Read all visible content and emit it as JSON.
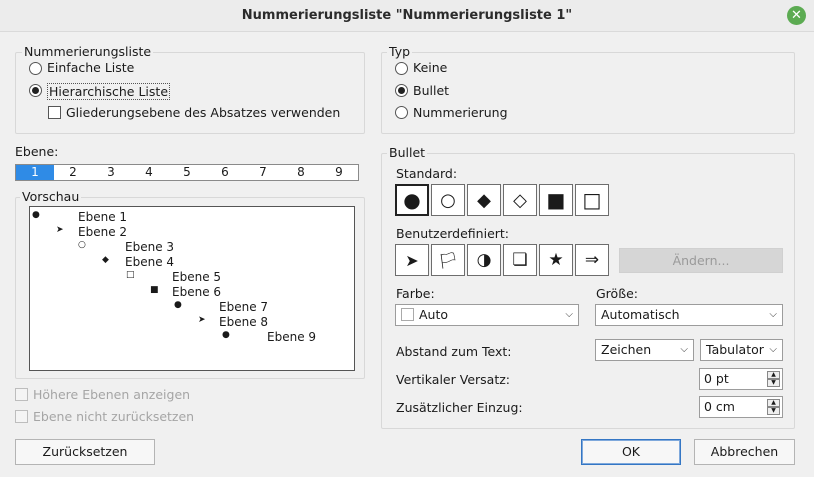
{
  "window": {
    "title": "Nummerierungsliste \"Nummerierungsliste 1\"",
    "close_symbol": "✕"
  },
  "numbering_list": {
    "group_label": "Nummerierungsliste",
    "simple": "Einfache Liste",
    "hierarchical": "Hierarchische Liste",
    "outline_checkbox": "Gliederungsebene des Absatzes verwenden",
    "selected": "hierarchical"
  },
  "type": {
    "group_label": "Typ",
    "none": "Keine",
    "bullet": "Bullet",
    "numbering": "Nummerierung",
    "selected": "bullet"
  },
  "level": {
    "label": "Ebene:",
    "items": [
      "1",
      "2",
      "3",
      "4",
      "5",
      "6",
      "7",
      "8",
      "9"
    ],
    "selected": "1"
  },
  "preview": {
    "label": "Vorschau",
    "lines": [
      {
        "text": "Ebene 1",
        "bullet": "●"
      },
      {
        "text": "Ebene 2",
        "bullet": "➤"
      },
      {
        "text": "Ebene 3",
        "bullet": "○"
      },
      {
        "text": "Ebene 4",
        "bullet": "◆"
      },
      {
        "text": "Ebene 5",
        "bullet": "□"
      },
      {
        "text": "Ebene 6",
        "bullet": "■"
      },
      {
        "text": "Ebene 7",
        "bullet": "●"
      },
      {
        "text": "Ebene 8",
        "bullet": "➤"
      },
      {
        "text": "Ebene 9",
        "bullet": "●"
      }
    ]
  },
  "options": {
    "show_higher": "Höhere Ebenen anzeigen",
    "no_reset": "Ebene nicht zurücksetzen"
  },
  "bullet": {
    "group_label": "Bullet",
    "standard_label": "Standard:",
    "standard_symbols": [
      "●",
      "○",
      "◆",
      "◇",
      "■",
      "□"
    ],
    "custom_label": "Benutzerdefiniert:",
    "custom_symbols": [
      "➤",
      "🏳",
      "◑",
      "❏",
      "★",
      "⇒"
    ],
    "change_button": "Ändern...",
    "color_label": "Farbe:",
    "color_value": "Auto",
    "size_label": "Größe:",
    "size_value": "Automatisch",
    "spacing_label": "Abstand zum Text:",
    "spacing_unit": "Zeichen",
    "spacing_sep": "Tabulator",
    "vertical_label": "Vertikaler Versatz:",
    "vertical_value": "0 pt",
    "indent_label": "Zusätzlicher Einzug:",
    "indent_value": "0 cm"
  },
  "buttons": {
    "reset": "Zurücksetzen",
    "ok": "OK",
    "cancel": "Abbrechen"
  },
  "colors": {
    "accent": "#2f8be6",
    "close": "#5cab52"
  }
}
